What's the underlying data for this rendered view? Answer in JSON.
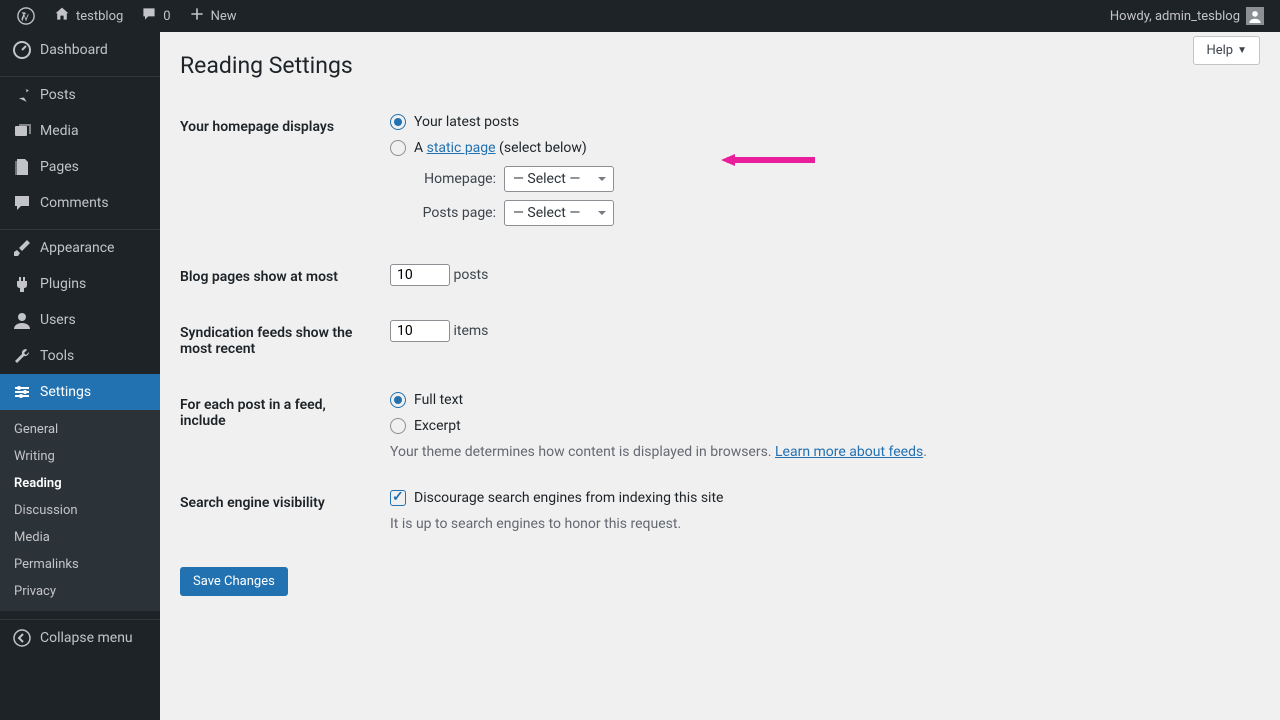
{
  "topbar": {
    "site_name": "testblog",
    "comments_count": "0",
    "new_label": "New",
    "howdy": "Howdy, admin_tesblog"
  },
  "sidebar": {
    "dashboard": "Dashboard",
    "posts": "Posts",
    "media": "Media",
    "pages": "Pages",
    "comments": "Comments",
    "appearance": "Appearance",
    "plugins": "Plugins",
    "users": "Users",
    "tools": "Tools",
    "settings": "Settings",
    "collapse": "Collapse menu"
  },
  "submenu": {
    "general": "General",
    "writing": "Writing",
    "reading": "Reading",
    "discussion": "Discussion",
    "media": "Media",
    "permalinks": "Permalinks",
    "privacy": "Privacy"
  },
  "content": {
    "help": "Help",
    "title": "Reading Settings",
    "homepage_label": "Your homepage displays",
    "radio_latest": "Your latest posts",
    "radio_static_prefix": "A ",
    "radio_static_link": "static page",
    "radio_static_suffix": " (select below)",
    "homepage_select_label": "Homepage:",
    "posts_page_select_label": "Posts page:",
    "select_placeholder": "— Select —",
    "blog_pages_label": "Blog pages show at most",
    "blog_pages_value": "10",
    "blog_pages_suffix": "posts",
    "syndication_label": "Syndication feeds show the most recent",
    "syndication_value": "10",
    "syndication_suffix": "items",
    "feed_include_label": "For each post in a feed, include",
    "radio_fulltext": "Full text",
    "radio_excerpt": "Excerpt",
    "feed_desc_prefix": "Your theme determines how content is displayed in browsers. ",
    "feed_desc_link": "Learn more about feeds",
    "feed_desc_suffix": ".",
    "search_visibility_label": "Search engine visibility",
    "search_checkbox_label": "Discourage search engines from indexing this site",
    "search_desc": "It is up to search engines to honor this request.",
    "save_button": "Save Changes"
  }
}
